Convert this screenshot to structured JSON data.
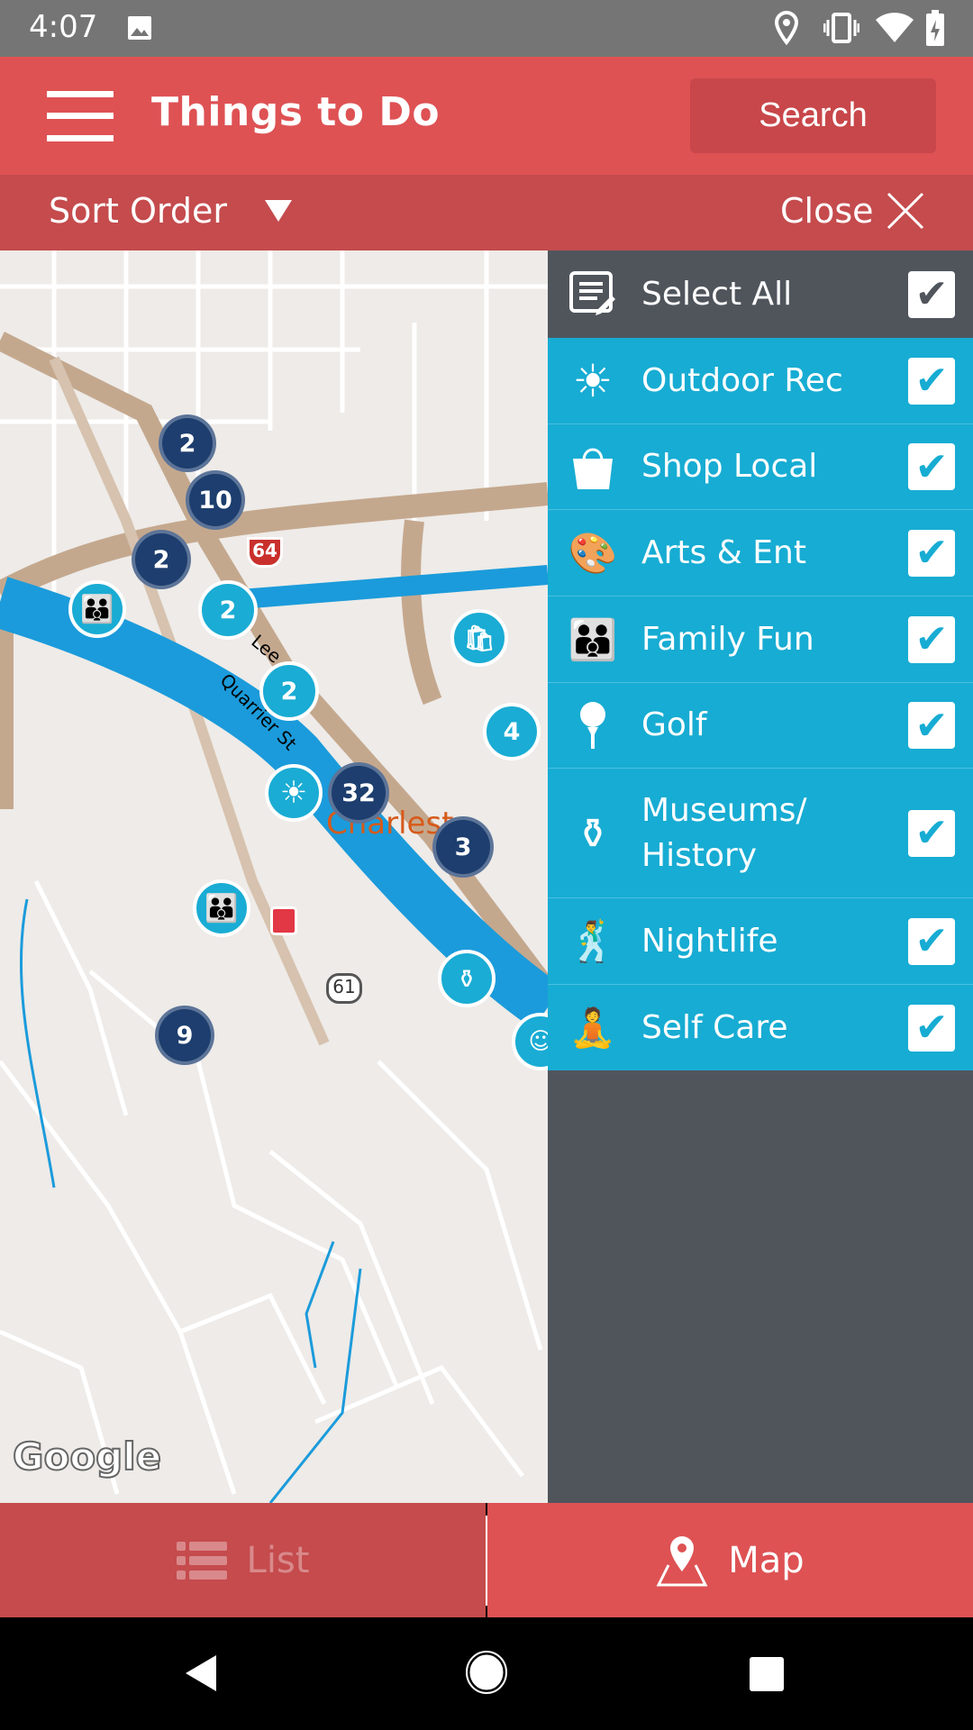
{
  "status_bar": {
    "time": "4:07",
    "icons": [
      "image-icon",
      "location-icon",
      "vibrate-icon",
      "wifi-icon",
      "battery-charging-icon"
    ]
  },
  "header": {
    "title": "Things to Do",
    "search_label": "Search",
    "menu_icon": "hamburger-icon"
  },
  "sort_bar": {
    "sort_label": "Sort Order",
    "close_label": "Close"
  },
  "map": {
    "city_label": "Charlest",
    "street_labels": [
      "Lee",
      "Quarrier St"
    ],
    "route_shields": [
      "64",
      "61"
    ],
    "logo": "Google",
    "clusters": [
      {
        "n": "2",
        "t": "dark"
      },
      {
        "n": "10",
        "t": "dark"
      },
      {
        "n": "2",
        "t": "dark"
      },
      {
        "n": "2",
        "t": "light"
      },
      {
        "n": "2",
        "t": "light"
      },
      {
        "n": "32",
        "t": "dark"
      },
      {
        "n": "3",
        "t": "dark"
      },
      {
        "n": "4",
        "t": "light"
      },
      {
        "n": "9",
        "t": "dark"
      }
    ]
  },
  "filter_panel": {
    "select_all": {
      "label": "Select All",
      "checked": true,
      "icon": "list-edit-icon"
    },
    "categories": [
      {
        "label": "Outdoor Rec",
        "checked": true,
        "icon": "sun-icon"
      },
      {
        "label": "Shop Local",
        "checked": true,
        "icon": "shopping-bag-icon"
      },
      {
        "label": "Arts & Ent",
        "checked": true,
        "icon": "palette-icon"
      },
      {
        "label": "Family Fun",
        "checked": true,
        "icon": "family-icon"
      },
      {
        "label": "Golf",
        "checked": true,
        "icon": "golf-icon"
      },
      {
        "label": "Museums/ History",
        "checked": true,
        "icon": "vase-icon"
      },
      {
        "label": "Nightlife",
        "checked": true,
        "icon": "dancer-icon"
      },
      {
        "label": "Self Care",
        "checked": true,
        "icon": "spa-icon"
      }
    ]
  },
  "bottom_tabs": {
    "list_label": "List",
    "map_label": "Map",
    "active": "Map"
  },
  "colors": {
    "header": "#DE5254",
    "sort_bar": "#C54B4D",
    "category": "#17ACD3",
    "panel": "#50555C",
    "cluster_dark": "#1D3E6E",
    "cluster_light": "#1AACD4"
  }
}
